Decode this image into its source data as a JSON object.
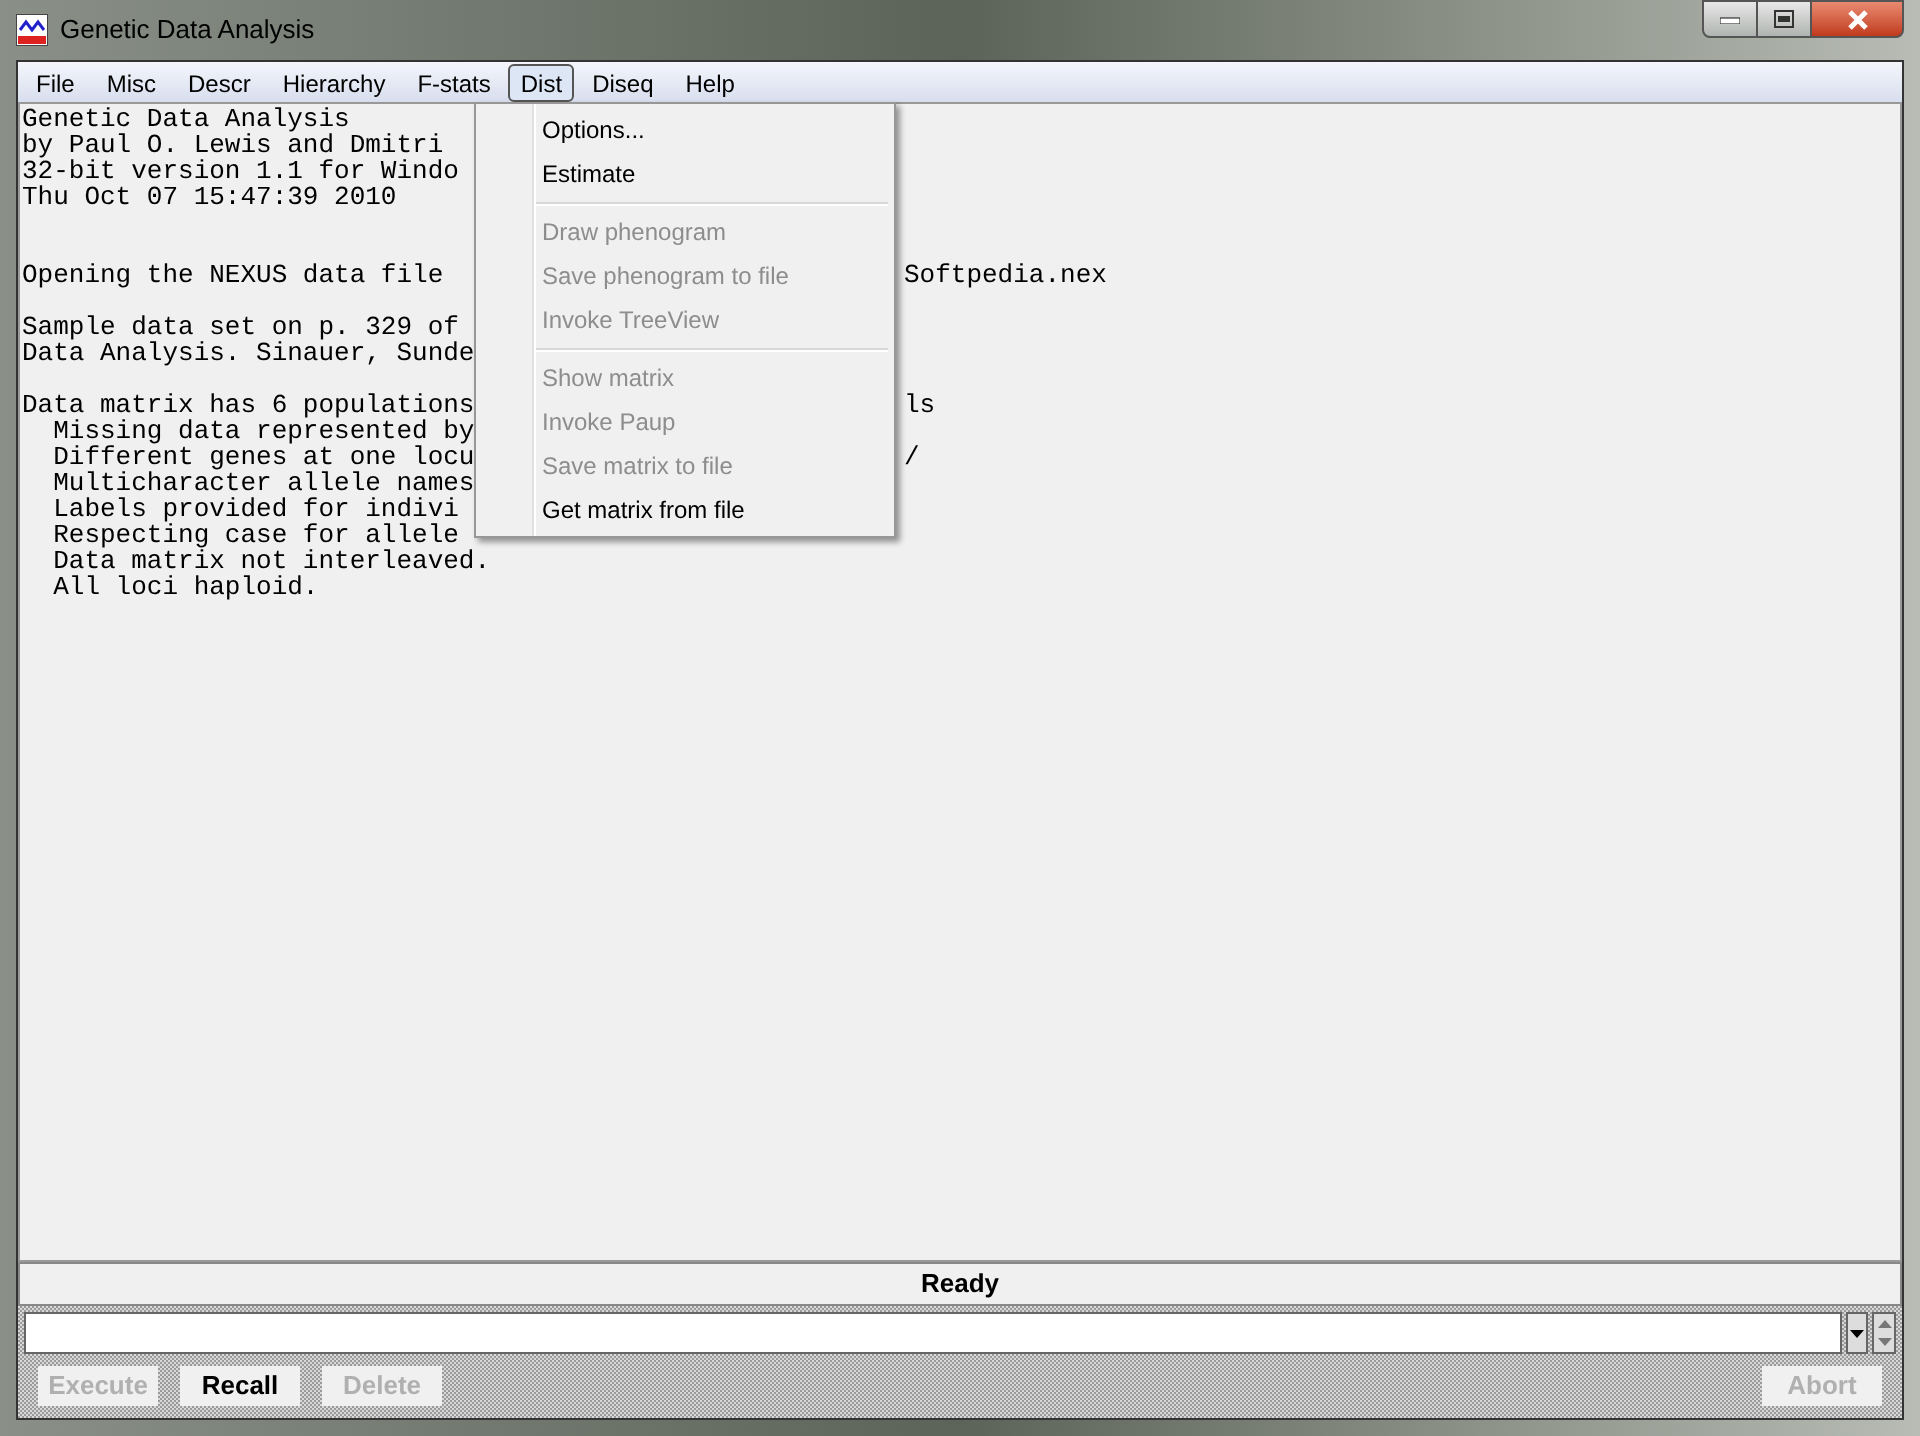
{
  "window": {
    "title": "Genetic Data Analysis"
  },
  "menu_bar": [
    {
      "label": "File",
      "selected": false
    },
    {
      "label": "Misc",
      "selected": false
    },
    {
      "label": "Descr",
      "selected": false
    },
    {
      "label": "Hierarchy",
      "selected": false
    },
    {
      "label": "F-stats",
      "selected": false
    },
    {
      "label": "Dist",
      "selected": true
    },
    {
      "label": "Diseq",
      "selected": false
    },
    {
      "label": "Help",
      "selected": false
    }
  ],
  "console_lines": [
    {
      "text": "Genetic Data Analysis"
    },
    {
      "text": "by Paul O. Lewis and Dmitri"
    },
    {
      "text": "32-bit version 1.1 for Windo"
    },
    {
      "text": "Thu Oct 07 15:47:39 2010"
    },
    {
      "kind": "blank"
    },
    {
      "kind": "blank"
    },
    {
      "text": "Opening the NEXUS data file",
      "right": "Softpedia.nex"
    },
    {
      "kind": "blank"
    },
    {
      "text": "Sample data set on p. 329 of"
    },
    {
      "text": "Data Analysis. Sinauer, Sunde"
    },
    {
      "kind": "blank"
    },
    {
      "text": "Data matrix has 6 populations",
      "right": "ls"
    },
    {
      "text": "  Missing data represented by"
    },
    {
      "text": "  Different genes at one locu",
      "right": "/"
    },
    {
      "text": "  Multicharacter allele names"
    },
    {
      "text": "  Labels provided for indivi"
    },
    {
      "text": "  Respecting case for allele"
    },
    {
      "text": "  Data matrix not interleaved."
    },
    {
      "text": "  All loci haploid."
    }
  ],
  "dropdown_menu": [
    {
      "kind": "item",
      "label": "Options...",
      "disabled": false
    },
    {
      "kind": "item",
      "label": "Estimate",
      "disabled": false
    },
    {
      "kind": "separator"
    },
    {
      "kind": "item",
      "label": "Draw phenogram",
      "disabled": true
    },
    {
      "kind": "item",
      "label": "Save phenogram to file",
      "disabled": true
    },
    {
      "kind": "item",
      "label": "Invoke TreeView",
      "disabled": true
    },
    {
      "kind": "separator"
    },
    {
      "kind": "item",
      "label": "Show matrix",
      "disabled": true
    },
    {
      "kind": "item",
      "label": "Invoke Paup",
      "disabled": true
    },
    {
      "kind": "item",
      "label": "Save matrix to file",
      "disabled": true
    },
    {
      "kind": "item",
      "label": "Get matrix from file",
      "disabled": false
    }
  ],
  "status_bar": {
    "text": "Ready"
  },
  "command_buttons": [
    {
      "label": "Execute",
      "disabled": true
    },
    {
      "label": "Recall",
      "disabled": false
    },
    {
      "label": "Delete",
      "disabled": true
    }
  ],
  "abort_button": {
    "label": "Abort",
    "disabled": true
  }
}
